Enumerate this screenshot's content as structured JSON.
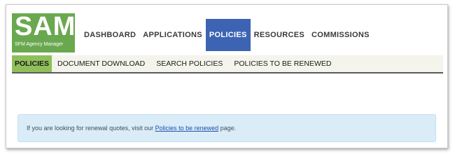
{
  "logo": {
    "title": "SAM",
    "subtitle": "SFM Agency Manager",
    "color": "#6aa84f"
  },
  "topnav": {
    "items": [
      {
        "label": "DASHBOARD",
        "active": false
      },
      {
        "label": "APPLICATIONS",
        "active": false
      },
      {
        "label": "POLICIES",
        "active": true
      },
      {
        "label": "RESOURCES",
        "active": false
      },
      {
        "label": "COMMISSIONS",
        "active": false
      }
    ],
    "active_color": "#3c64b3"
  },
  "subnav": {
    "items": [
      {
        "label": "POLICIES",
        "active": true
      },
      {
        "label": "DOCUMENT DOWNLOAD",
        "active": false
      },
      {
        "label": "SEARCH POLICIES",
        "active": false
      },
      {
        "label": "POLICIES TO BE RENEWED",
        "active": false
      }
    ],
    "active_color": "#8fbf5a"
  },
  "notice": {
    "text_before": "If you are looking for renewal quotes, visit our ",
    "link_text": "Policies to be renewed",
    "text_after": " page."
  }
}
